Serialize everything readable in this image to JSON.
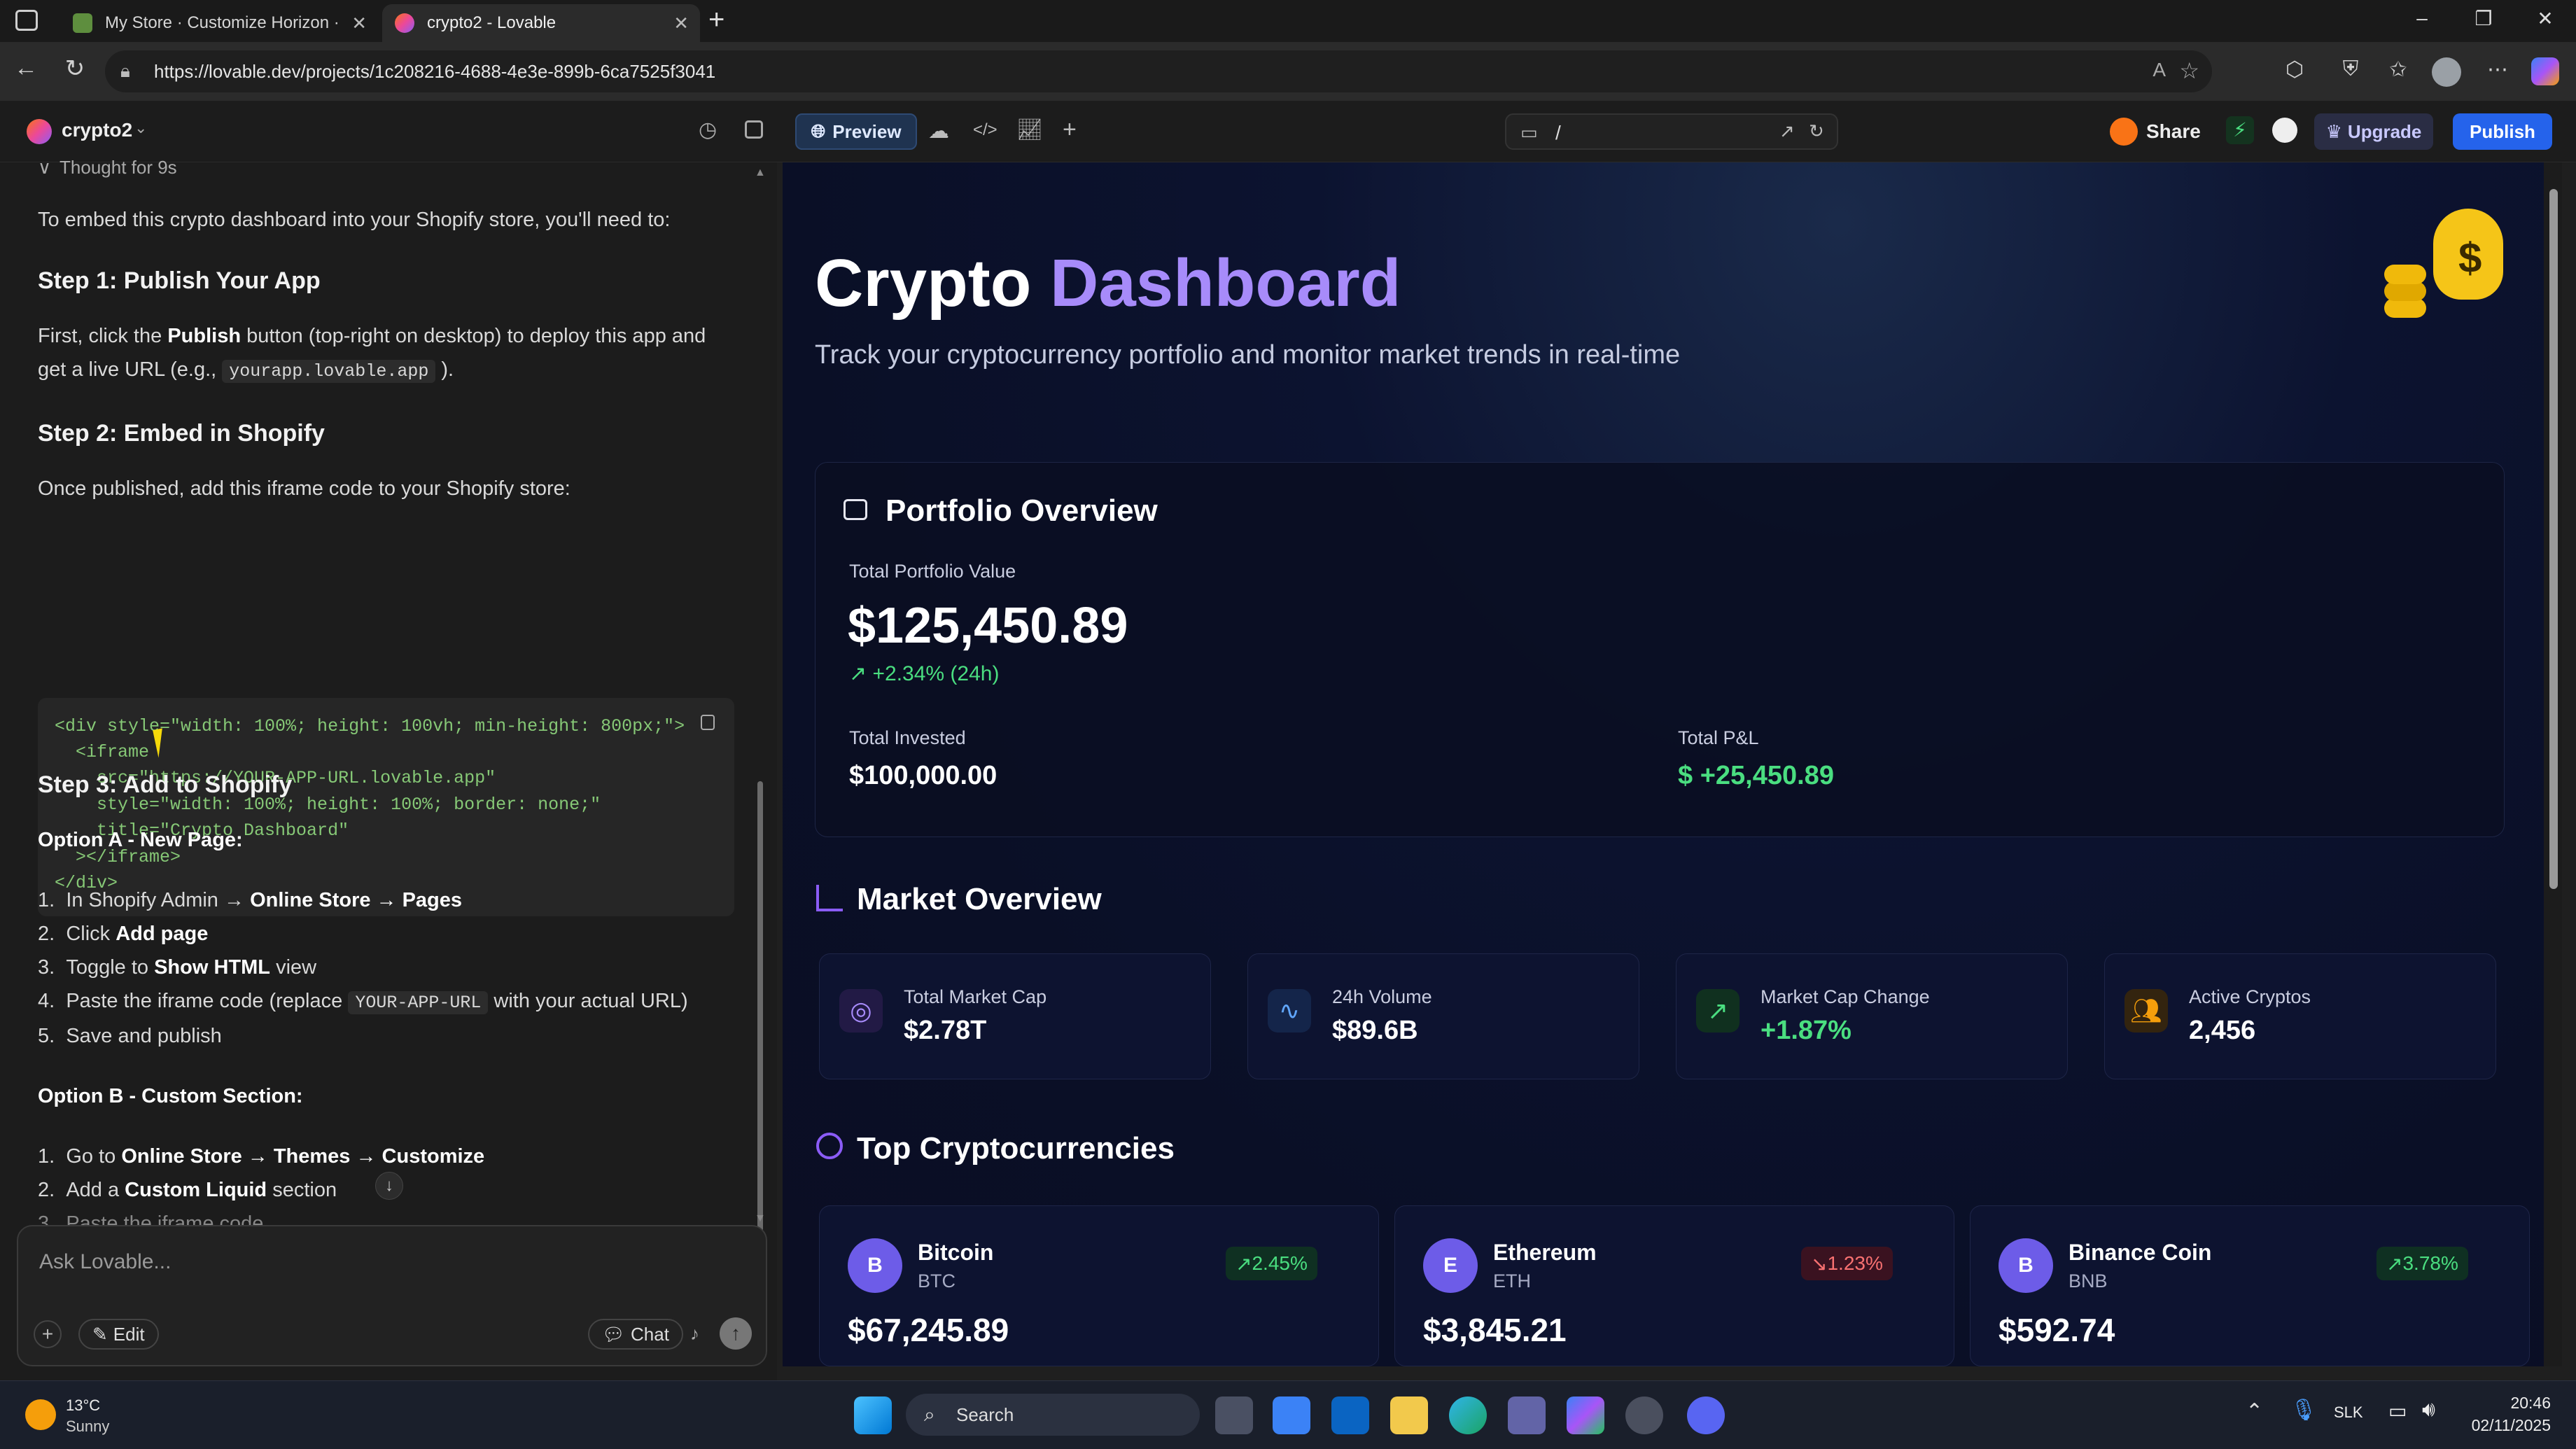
{
  "browser": {
    "tabs": [
      {
        "title": "My Store · Customize Horizon · Sh",
        "active": false
      },
      {
        "title": "crypto2 - Lovable",
        "active": true
      }
    ],
    "url": "https://lovable.dev/projects/1c208216-4688-4e3e-899b-6ca7525f3041"
  },
  "app": {
    "project_name": "crypto2",
    "preview_label": "Preview",
    "route": "/",
    "share_label": "Share",
    "upgrade_label": "Upgrade",
    "publish_label": "Publish"
  },
  "chat": {
    "thought": "Thought for 9s",
    "intro": "To embed this crypto dashboard into your Shopify store, you'll need to:",
    "step1_title": "Step 1: Publish Your App",
    "step1_a": "First, click the",
    "step1_bold": "Publish",
    "step1_b": "button (top-right on desktop) to deploy this app and",
    "step1_c": "get a live URL (e.g.,",
    "step1_code": "yourapp.lovable.app",
    "step1_d": ").",
    "step2_title": "Step 2: Embed in Shopify",
    "step2_text": "Once published, add this iframe code to your Shopify store:",
    "code_lines": [
      "<div style=\"width: 100%; height: 100vh; min-height: 800px;\">",
      "  <iframe",
      "    src=\"https://YOUR-APP-URL.lovable.app\"",
      "    style=\"width: 100%; height: 100%; border: none;\"",
      "    title=\"Crypto Dashboard\"",
      "  ></iframe>",
      "</div>"
    ],
    "step3_title": "Step 3: Add to Shopify",
    "optionA": "Option A - New Page:",
    "optA_1a": "In Shopify Admin →",
    "optA_1b": "Online Store → Pages",
    "optA_2a": "Click",
    "optA_2b": "Add page",
    "optA_3a": "Toggle to",
    "optA_3b": "Show HTML",
    "optA_3c": "view",
    "optA_4a": "Paste the iframe code (replace",
    "optA_4code": "YOUR-APP-URL",
    "optA_4b": "with your actual URL)",
    "optA_5": "Save and publish",
    "optionB": "Option B - Custom Section:",
    "optB_1a": "Go to",
    "optB_1b": "Online Store → Themes → Customize",
    "optB_2a": "Add a",
    "optB_2b": "Custom Liquid",
    "optB_2c": "section",
    "optB_3": "Paste the iframe code",
    "input_placeholder": "Ask Lovable...",
    "edit_label": "Edit",
    "chat_label": "Chat"
  },
  "dashboard": {
    "title_a": "Crypto",
    "title_b": "Dashboard",
    "subtitle": "Track your cryptocurrency portfolio and monitor market trends in real-time",
    "portfolio": {
      "heading": "Portfolio Overview",
      "total_label": "Total Portfolio Value",
      "total_value": "$125,450.89",
      "change": "+2.34% (24h)",
      "invested_label": "Total Invested",
      "invested_value": "$100,000.00",
      "pnl_label": "Total P&L",
      "pnl_value": "+25,450.89"
    },
    "market": {
      "heading": "Market Overview",
      "stats": [
        {
          "label": "Total Market Cap",
          "value": "$2.78T",
          "icon": "globe-icon",
          "color": "#a78bfa"
        },
        {
          "label": "24h Volume",
          "value": "$89.6B",
          "icon": "activity-icon",
          "color": "#60a5fa"
        },
        {
          "label": "Market Cap Change",
          "value": "+1.87%",
          "icon": "trending-up-icon",
          "color": "#4ade80"
        },
        {
          "label": "Active Cryptos",
          "value": "2,456",
          "icon": "users-icon",
          "color": "#f59e0b"
        }
      ]
    },
    "top": {
      "heading": "Top Cryptocurrencies",
      "coins": [
        {
          "letter": "B",
          "name": "Bitcoin",
          "symbol": "BTC",
          "change": "2.45%",
          "price": "$67,245.89",
          "up": true
        },
        {
          "letter": "E",
          "name": "Ethereum",
          "symbol": "ETH",
          "change": "1.23%",
          "price": "$3,845.21",
          "up": false
        },
        {
          "letter": "B",
          "name": "Binance Coin",
          "symbol": "BNB",
          "change": "3.78%",
          "price": "$592.74",
          "up": true
        }
      ]
    }
  },
  "taskbar": {
    "temp": "13°C",
    "weather": "Sunny",
    "search": "Search",
    "lang": "SLK",
    "time": "20:46",
    "date": "02/11/2025"
  },
  "colors": {
    "accent_purple": "#8b5cf6",
    "publish_blue": "#2563eb",
    "positive_green": "#4ade80",
    "negative_red": "#f87171"
  }
}
